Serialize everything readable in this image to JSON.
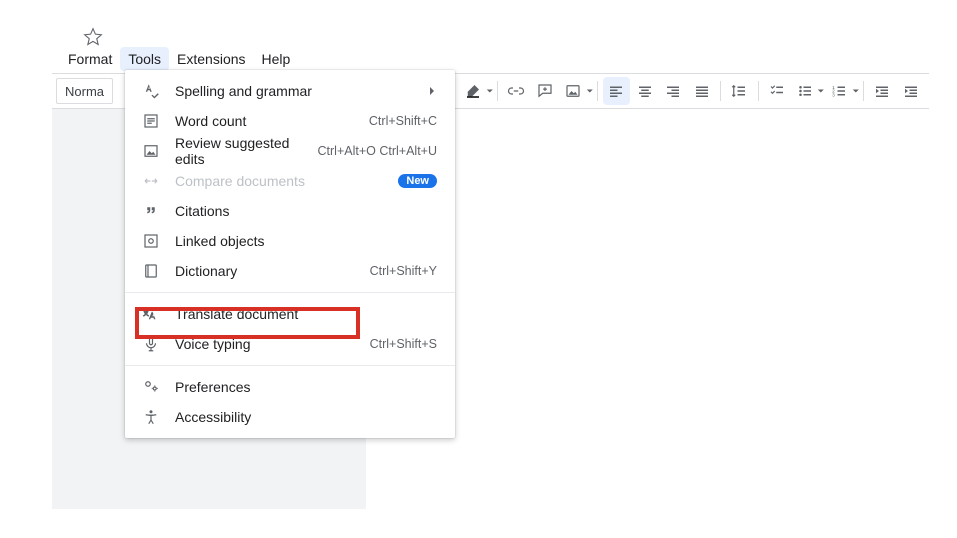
{
  "star": {},
  "menubar": {
    "items": [
      {
        "label": "Format"
      },
      {
        "label": "Tools"
      },
      {
        "label": "Extensions"
      },
      {
        "label": "Help"
      }
    ],
    "active_index": 1
  },
  "toolbar": {
    "style_selector": "Norma"
  },
  "dropdown": {
    "groups": [
      [
        {
          "icon": "spell",
          "label": "Spelling and grammar",
          "submenu": true
        },
        {
          "icon": "wordcount",
          "label": "Word count",
          "shortcut": "Ctrl+Shift+C"
        },
        {
          "icon": "review",
          "label": "Review suggested edits",
          "shortcut": "Ctrl+Alt+O Ctrl+Alt+U"
        },
        {
          "icon": "compare",
          "label": "Compare documents",
          "badge": "New",
          "disabled": true
        },
        {
          "icon": "citations",
          "label": "Citations"
        },
        {
          "icon": "linked",
          "label": "Linked objects"
        },
        {
          "icon": "dictionary",
          "label": "Dictionary",
          "shortcut": "Ctrl+Shift+Y"
        }
      ],
      [
        {
          "icon": "translate",
          "label": "Translate document"
        },
        {
          "icon": "voice",
          "label": "Voice typing",
          "shortcut": "Ctrl+Shift+S"
        }
      ],
      [
        {
          "icon": "prefs",
          "label": "Preferences"
        },
        {
          "icon": "accessibility",
          "label": "Accessibility"
        }
      ]
    ]
  }
}
